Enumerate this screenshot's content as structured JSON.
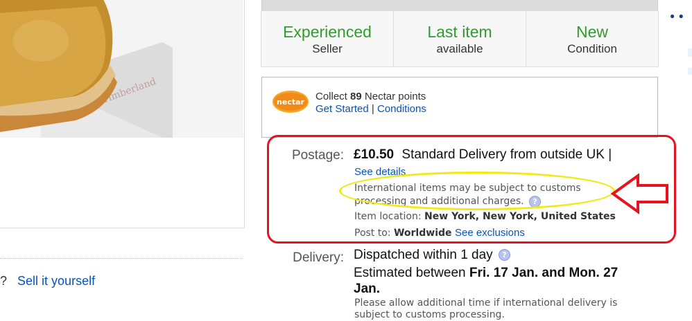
{
  "highlights": [
    {
      "title": "Experienced",
      "subtitle": "Seller"
    },
    {
      "title": "Last item",
      "subtitle": "available"
    },
    {
      "title": "New",
      "subtitle": "Condition"
    }
  ],
  "nectar": {
    "logo_text": "nectar",
    "collect_prefix": "Collect",
    "points": "89",
    "points_suffix": "Nectar points",
    "get_started": "Get Started",
    "separator": "|",
    "conditions": "Conditions"
  },
  "postage": {
    "label": "Postage:",
    "price": "£10.50",
    "service": "Standard Delivery from outside UK |",
    "see_details": "See details",
    "intl_line1": "International items may be subject to customs",
    "intl_line2": "processing and additional charges.",
    "item_location_label": "Item location:",
    "item_location_value": "New York, New York, United States",
    "post_to_label": "Post to:",
    "post_to_value": "Worldwide",
    "see_exclusions": "See exclusions"
  },
  "delivery": {
    "label": "Delivery:",
    "dispatch": "Dispatched within 1 day",
    "estimate_prefix": "Estimated between",
    "estimate_dates": "Fri. 17 Jan. and Mon. 27 Jan.",
    "allow_text": "Please allow additional time if international delivery is subject to customs processing."
  },
  "left": {
    "question_mark": "?",
    "sell_link": "Sell it yourself"
  },
  "help_icon_glyph": "?",
  "colors": {
    "highlight_green": "#2e9d2e",
    "link_blue": "#0654ba",
    "annotation_red": "#e8121f",
    "annotation_yellow": "#f2ea18"
  }
}
